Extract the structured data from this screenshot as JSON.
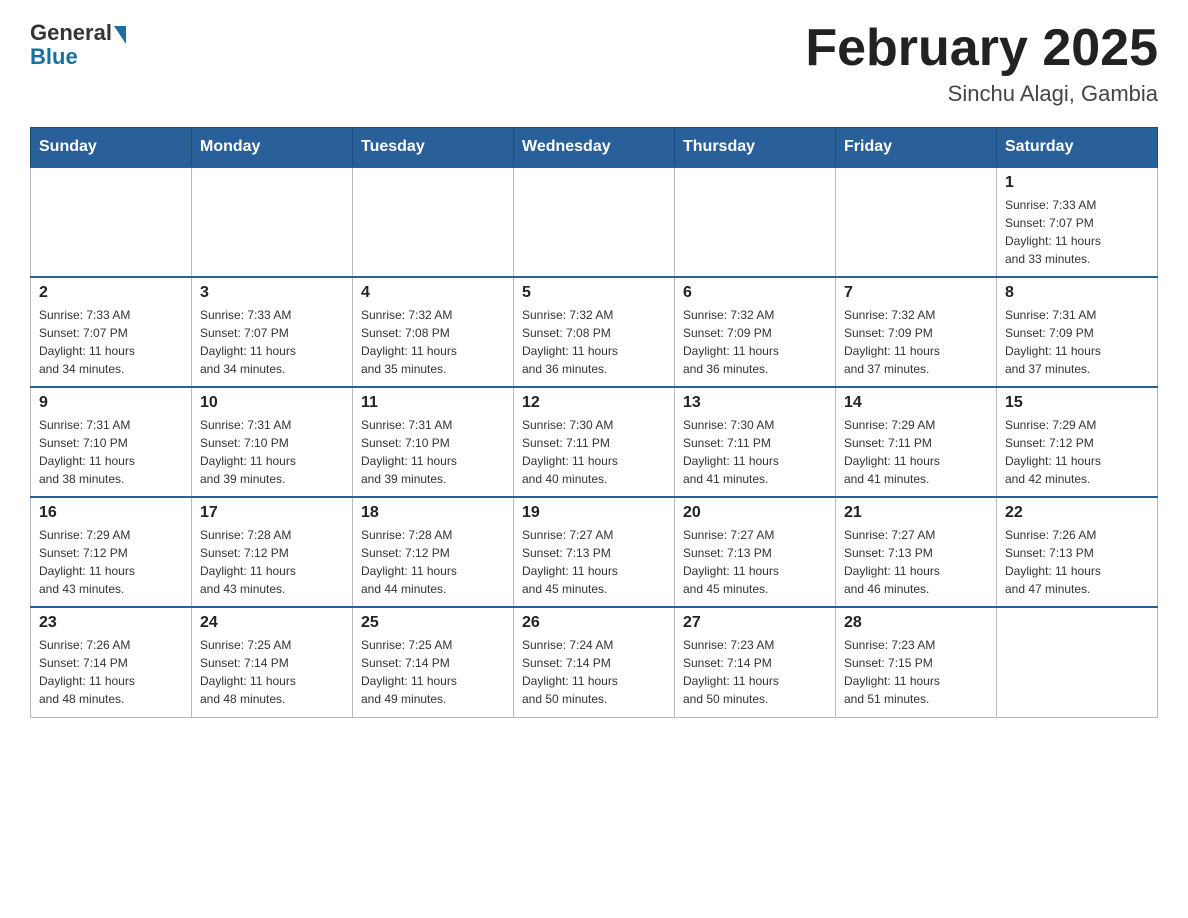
{
  "header": {
    "logo_general": "General",
    "logo_blue": "Blue",
    "month_title": "February 2025",
    "location": "Sinchu Alagi, Gambia"
  },
  "weekdays": [
    "Sunday",
    "Monday",
    "Tuesday",
    "Wednesday",
    "Thursday",
    "Friday",
    "Saturday"
  ],
  "weeks": [
    [
      {
        "day": "",
        "info": ""
      },
      {
        "day": "",
        "info": ""
      },
      {
        "day": "",
        "info": ""
      },
      {
        "day": "",
        "info": ""
      },
      {
        "day": "",
        "info": ""
      },
      {
        "day": "",
        "info": ""
      },
      {
        "day": "1",
        "info": "Sunrise: 7:33 AM\nSunset: 7:07 PM\nDaylight: 11 hours\nand 33 minutes."
      }
    ],
    [
      {
        "day": "2",
        "info": "Sunrise: 7:33 AM\nSunset: 7:07 PM\nDaylight: 11 hours\nand 34 minutes."
      },
      {
        "day": "3",
        "info": "Sunrise: 7:33 AM\nSunset: 7:07 PM\nDaylight: 11 hours\nand 34 minutes."
      },
      {
        "day": "4",
        "info": "Sunrise: 7:32 AM\nSunset: 7:08 PM\nDaylight: 11 hours\nand 35 minutes."
      },
      {
        "day": "5",
        "info": "Sunrise: 7:32 AM\nSunset: 7:08 PM\nDaylight: 11 hours\nand 36 minutes."
      },
      {
        "day": "6",
        "info": "Sunrise: 7:32 AM\nSunset: 7:09 PM\nDaylight: 11 hours\nand 36 minutes."
      },
      {
        "day": "7",
        "info": "Sunrise: 7:32 AM\nSunset: 7:09 PM\nDaylight: 11 hours\nand 37 minutes."
      },
      {
        "day": "8",
        "info": "Sunrise: 7:31 AM\nSunset: 7:09 PM\nDaylight: 11 hours\nand 37 minutes."
      }
    ],
    [
      {
        "day": "9",
        "info": "Sunrise: 7:31 AM\nSunset: 7:10 PM\nDaylight: 11 hours\nand 38 minutes."
      },
      {
        "day": "10",
        "info": "Sunrise: 7:31 AM\nSunset: 7:10 PM\nDaylight: 11 hours\nand 39 minutes."
      },
      {
        "day": "11",
        "info": "Sunrise: 7:31 AM\nSunset: 7:10 PM\nDaylight: 11 hours\nand 39 minutes."
      },
      {
        "day": "12",
        "info": "Sunrise: 7:30 AM\nSunset: 7:11 PM\nDaylight: 11 hours\nand 40 minutes."
      },
      {
        "day": "13",
        "info": "Sunrise: 7:30 AM\nSunset: 7:11 PM\nDaylight: 11 hours\nand 41 minutes."
      },
      {
        "day": "14",
        "info": "Sunrise: 7:29 AM\nSunset: 7:11 PM\nDaylight: 11 hours\nand 41 minutes."
      },
      {
        "day": "15",
        "info": "Sunrise: 7:29 AM\nSunset: 7:12 PM\nDaylight: 11 hours\nand 42 minutes."
      }
    ],
    [
      {
        "day": "16",
        "info": "Sunrise: 7:29 AM\nSunset: 7:12 PM\nDaylight: 11 hours\nand 43 minutes."
      },
      {
        "day": "17",
        "info": "Sunrise: 7:28 AM\nSunset: 7:12 PM\nDaylight: 11 hours\nand 43 minutes."
      },
      {
        "day": "18",
        "info": "Sunrise: 7:28 AM\nSunset: 7:12 PM\nDaylight: 11 hours\nand 44 minutes."
      },
      {
        "day": "19",
        "info": "Sunrise: 7:27 AM\nSunset: 7:13 PM\nDaylight: 11 hours\nand 45 minutes."
      },
      {
        "day": "20",
        "info": "Sunrise: 7:27 AM\nSunset: 7:13 PM\nDaylight: 11 hours\nand 45 minutes."
      },
      {
        "day": "21",
        "info": "Sunrise: 7:27 AM\nSunset: 7:13 PM\nDaylight: 11 hours\nand 46 minutes."
      },
      {
        "day": "22",
        "info": "Sunrise: 7:26 AM\nSunset: 7:13 PM\nDaylight: 11 hours\nand 47 minutes."
      }
    ],
    [
      {
        "day": "23",
        "info": "Sunrise: 7:26 AM\nSunset: 7:14 PM\nDaylight: 11 hours\nand 48 minutes."
      },
      {
        "day": "24",
        "info": "Sunrise: 7:25 AM\nSunset: 7:14 PM\nDaylight: 11 hours\nand 48 minutes."
      },
      {
        "day": "25",
        "info": "Sunrise: 7:25 AM\nSunset: 7:14 PM\nDaylight: 11 hours\nand 49 minutes."
      },
      {
        "day": "26",
        "info": "Sunrise: 7:24 AM\nSunset: 7:14 PM\nDaylight: 11 hours\nand 50 minutes."
      },
      {
        "day": "27",
        "info": "Sunrise: 7:23 AM\nSunset: 7:14 PM\nDaylight: 11 hours\nand 50 minutes."
      },
      {
        "day": "28",
        "info": "Sunrise: 7:23 AM\nSunset: 7:15 PM\nDaylight: 11 hours\nand 51 minutes."
      },
      {
        "day": "",
        "info": ""
      }
    ]
  ]
}
